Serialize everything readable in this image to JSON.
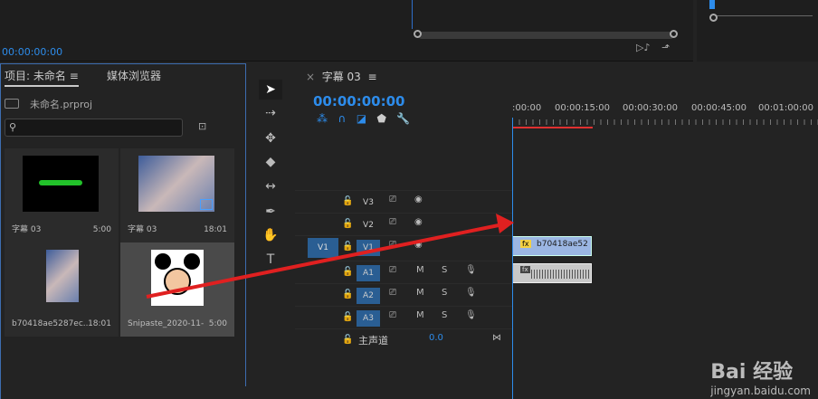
{
  "program": {
    "timecode": "00:00:00:00"
  },
  "project": {
    "tab_project": "项目: 未命名",
    "tab_browser": "媒体浏览器",
    "file_name": "未命名.prproj",
    "search_placeholder": "",
    "items": [
      {
        "name": "字幕 03",
        "duration": "5:00"
      },
      {
        "name": "字幕 03",
        "duration": "18:01"
      },
      {
        "name": "b70418ae5287ec...",
        "duration": "18:01"
      },
      {
        "name": "Snipaste_2020-11-...",
        "duration": "5:00"
      }
    ]
  },
  "timeline": {
    "sequence_tab": "字幕 03",
    "timecode": "00:00:00:00",
    "ruler_labels": [
      ":00:00",
      "00:00:15:00",
      "00:00:30:00",
      "00:00:45:00",
      "00:01:00:00"
    ],
    "tracks": {
      "v3": "V3",
      "v2": "V2",
      "v1": "V1",
      "source_v1": "V1",
      "a1": "A1",
      "a2": "A2",
      "a3": "A3",
      "mute": "M",
      "solo": "S",
      "master_label": "主声道",
      "master_value": "0.0"
    },
    "video_clip_label": "b70418ae52",
    "fx_label": "fx"
  },
  "watermark": {
    "text": "Bai 经验",
    "url_text": "jingyan.baidu.com"
  },
  "colors": {
    "accent": "#2d8ceb",
    "arrow": "#e02020"
  }
}
